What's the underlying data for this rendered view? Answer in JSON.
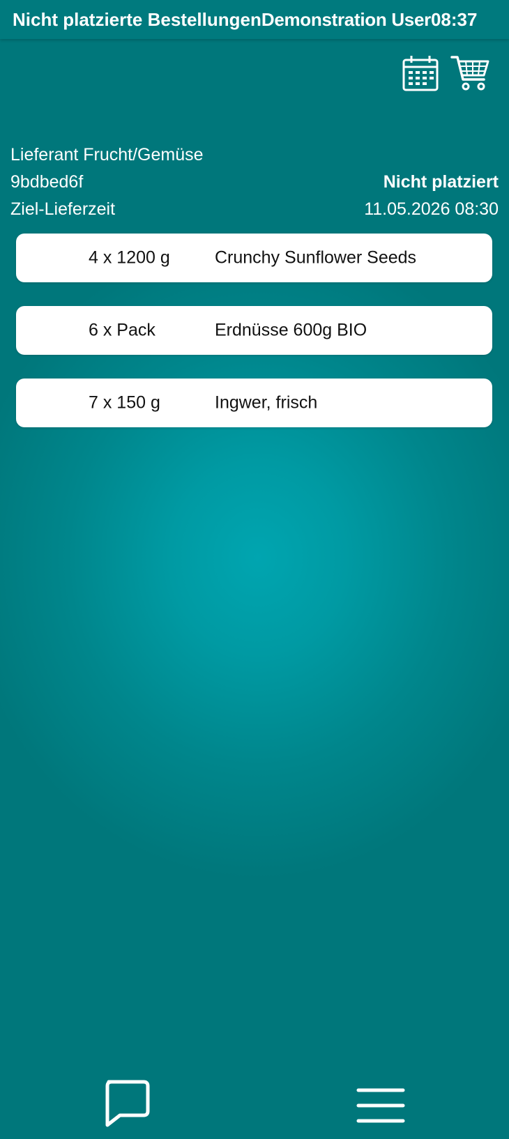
{
  "header": {
    "title": "Nicht platzierte Bestellungen",
    "user": "Demonstration User",
    "time": "08:37"
  },
  "toolbar": {
    "calendar_icon": "calendar-icon",
    "cart_icon": "cart-icon"
  },
  "order_info": {
    "supplier": "Lieferant Frucht/Gemüse",
    "order_id": "9bdbed6f",
    "status": "Nicht platziert",
    "target_label": "Ziel-Lieferzeit",
    "target_time": "11.05.2026 08:30"
  },
  "items": [
    {
      "quantity": "4 x 1200 g",
      "name": "Crunchy Sunflower Seeds"
    },
    {
      "quantity": "6 x Pack",
      "name": "Erdnüsse 600g BIO"
    },
    {
      "quantity": "7 x 150 g",
      "name": "Ingwer, frisch"
    }
  ],
  "bottom_nav": {
    "chat_icon": "chat-icon",
    "menu_icon": "menu-icon"
  },
  "colors": {
    "background": "#00777b",
    "background_center": "#00a5b0",
    "card": "#ffffff",
    "text_light": "#ffffff",
    "text_dark": "#111111"
  }
}
